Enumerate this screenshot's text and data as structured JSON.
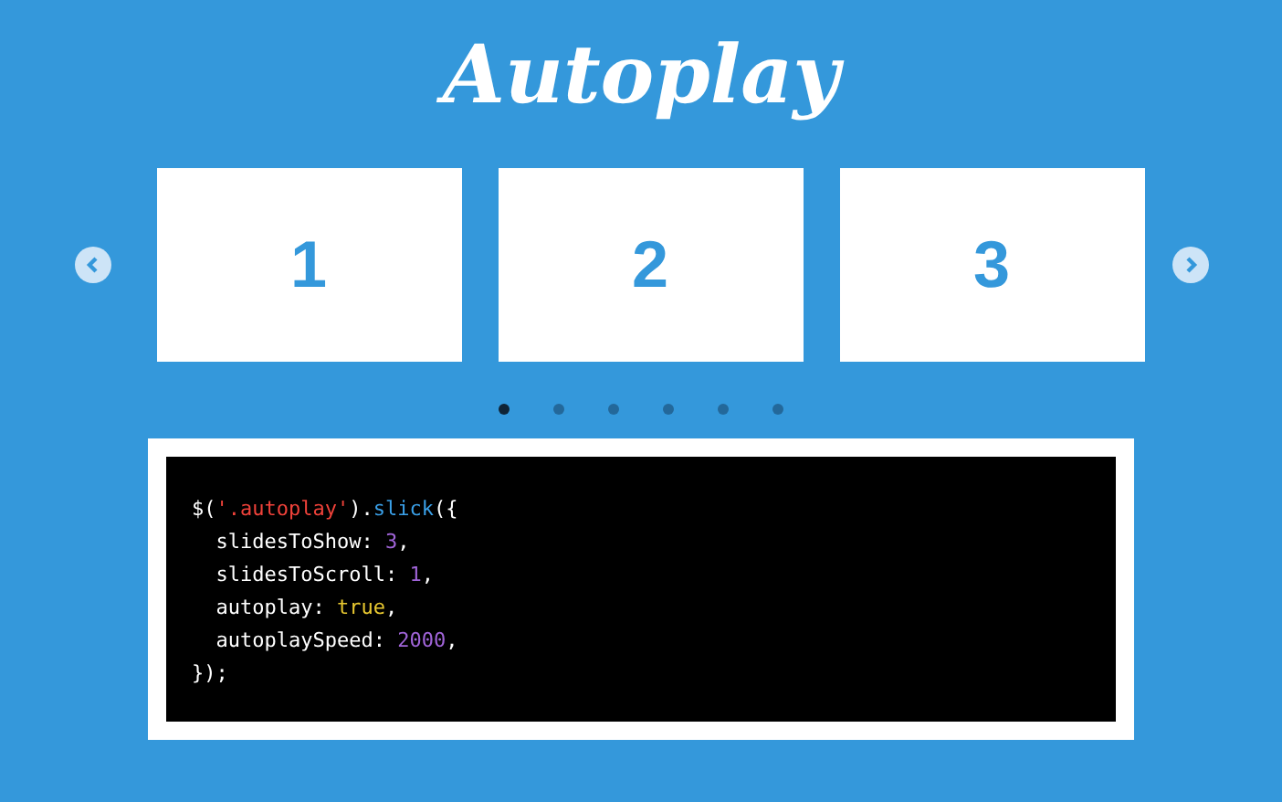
{
  "title": "Autoplay",
  "slides": [
    "1",
    "2",
    "3"
  ],
  "dots": [
    {
      "selected": true
    },
    {
      "selected": false
    },
    {
      "selected": false
    },
    {
      "selected": false
    },
    {
      "selected": false
    },
    {
      "selected": false
    }
  ],
  "code": [
    [
      {
        "kind": "plain",
        "text": "$("
      },
      {
        "kind": "string",
        "text": "'.autoplay'"
      },
      {
        "kind": "plain",
        "text": ")."
      },
      {
        "kind": "func",
        "text": "slick"
      },
      {
        "kind": "plain",
        "text": "({"
      }
    ],
    [
      {
        "kind": "plain",
        "text": "  slidesToShow: "
      },
      {
        "kind": "number",
        "text": "3"
      },
      {
        "kind": "plain",
        "text": ","
      }
    ],
    [
      {
        "kind": "plain",
        "text": "  slidesToScroll: "
      },
      {
        "kind": "number",
        "text": "1"
      },
      {
        "kind": "plain",
        "text": ","
      }
    ],
    [
      {
        "kind": "plain",
        "text": "  autoplay: "
      },
      {
        "kind": "keyword",
        "text": "true"
      },
      {
        "kind": "plain",
        "text": ","
      }
    ],
    [
      {
        "kind": "plain",
        "text": "  autoplaySpeed: "
      },
      {
        "kind": "number",
        "text": "2000"
      },
      {
        "kind": "plain",
        "text": ","
      }
    ],
    [
      {
        "kind": "plain",
        "text": "});"
      }
    ]
  ]
}
